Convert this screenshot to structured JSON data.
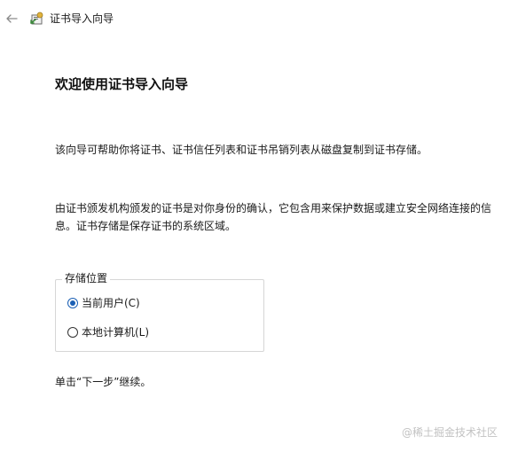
{
  "titlebar": {
    "back_icon": "back-arrow-icon",
    "app_icon": "certificate-icon",
    "title": "证书导入向导"
  },
  "main": {
    "heading": "欢迎使用证书导入向导",
    "paragraph1": "该向导可帮助你将证书、证书信任列表和证书吊销列表从磁盘复制到证书存储。",
    "paragraph2": "由证书颁发机构颁发的证书是对你身份的确认，它包含用来保护数据或建立安全网络连接的信息。证书存储是保存证书的系统区域。",
    "storage_group": {
      "label": "存储位置",
      "options": [
        {
          "label": "当前用户(C)",
          "selected": true
        },
        {
          "label": "本地计算机(L)",
          "selected": false
        }
      ]
    },
    "hint": "单击“下一步”继续。"
  },
  "watermark": "@稀土掘金技术社区",
  "colors": {
    "accent": "#1a5fb4",
    "text": "#1a1a1a",
    "border": "#d6d6d6",
    "watermark": "#c2c2c2"
  }
}
